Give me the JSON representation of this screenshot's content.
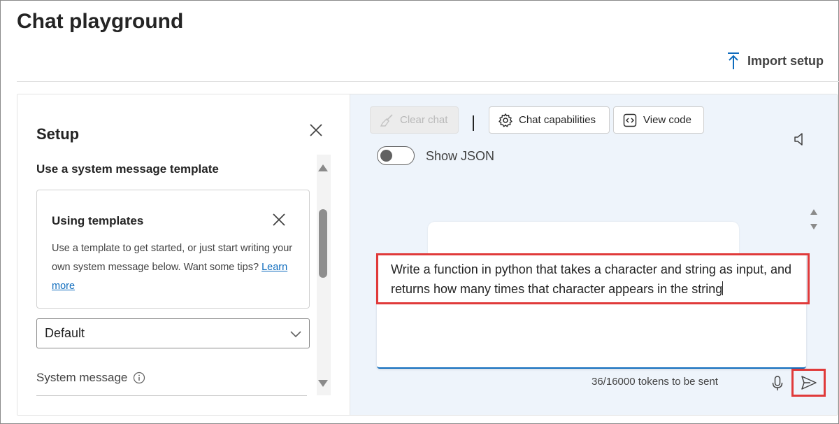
{
  "page": {
    "title": "Chat playground"
  },
  "header": {
    "import_label": "Import setup",
    "import_icon": "arrow-upload-icon"
  },
  "setup": {
    "title": "Setup",
    "section_label": "Use a system message template",
    "template_card": {
      "title": "Using templates",
      "body": "Use a template to get started, or just start writing your own system message below. Want some tips?",
      "link": "Learn more"
    },
    "template_select": {
      "value": "Default"
    },
    "system_message_label": "System message"
  },
  "chat": {
    "toolbar": {
      "clear_label": "Clear chat",
      "capabilities_label": "Chat capabilities",
      "view_code_label": "View code"
    },
    "show_json_label": "Show JSON",
    "show_json_on": false,
    "input_text": "Write a function in python that takes a character and string as input, and returns how many times that character appears in the string",
    "token_status": "36/16000 tokens to be sent"
  },
  "colors": {
    "accent": "#0f6cbd",
    "highlight": "#e03a3a",
    "chat_bg": "#eef4fb"
  }
}
